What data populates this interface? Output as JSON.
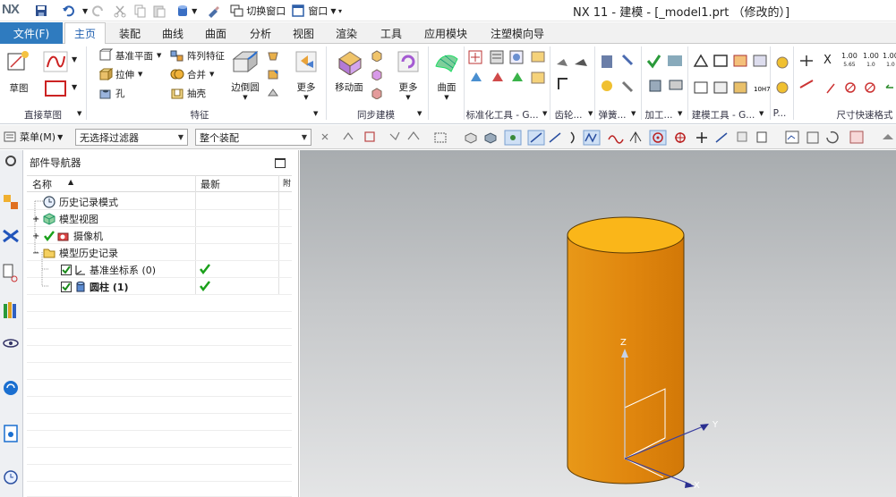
{
  "app": {
    "logo": "NX",
    "window_title": "NX 11 - 建模 - [_model1.prt （修改的）]",
    "switch_window": "切换窗口",
    "window_menu": "窗口"
  },
  "tabs": [
    {
      "label": "文件(F)"
    },
    {
      "label": "主页",
      "active": true
    },
    {
      "label": "装配"
    },
    {
      "label": "曲线"
    },
    {
      "label": "曲面"
    },
    {
      "label": "分析"
    },
    {
      "label": "视图"
    },
    {
      "label": "渲染"
    },
    {
      "label": "工具"
    },
    {
      "label": "应用模块"
    },
    {
      "label": "注塑模向导"
    }
  ],
  "ribbon": {
    "sketch": "草图",
    "datum_plane": "基准平面",
    "extrude": "拉伸",
    "hole": "孔",
    "pattern_feature": "阵列特征",
    "unite": "合并",
    "shell": "抽壳",
    "edge_blend": "边倒圆",
    "more1": "更多",
    "move_face": "移动面",
    "more2": "更多",
    "surface": "曲面",
    "groups": {
      "direct_sketch": "直接草图",
      "feature": "特征",
      "sync_modeling": "同步建模",
      "standard_tools": "标准化工具 - G...",
      "gear": "齿轮...",
      "spring": "弹簧...",
      "machining": "加工...",
      "modeling_tools": "建模工具 - G...",
      "p": "P...",
      "dim_quick": "尺寸快速格式"
    },
    "dim_values": {
      "a": "1.00",
      "b": "1.00",
      "c": "1.00"
    },
    "x_label": "X"
  },
  "filterbar": {
    "menu": "菜单(M)",
    "filter": "无选择过滤器",
    "assembly_scope": "整个装配"
  },
  "navigator": {
    "title": "部件导航器",
    "col_name": "名称",
    "col_latest": "最新",
    "col_third": "附",
    "items": [
      {
        "label": "历史记录模式"
      },
      {
        "label": "模型视图"
      },
      {
        "label": "摄像机"
      },
      {
        "label": "模型历史记录"
      },
      {
        "label": "基准坐标系 (0)"
      },
      {
        "label": "圆柱 (1)"
      }
    ]
  },
  "viewport": {
    "axis_z": "Z",
    "axis_y": "Y",
    "axis_x": "X"
  },
  "colors": {
    "file_tab": "#2f7bbf",
    "cylinder_side": "#e0860e",
    "cylinder_top": "#fab619",
    "check_green": "#1aa01a"
  }
}
